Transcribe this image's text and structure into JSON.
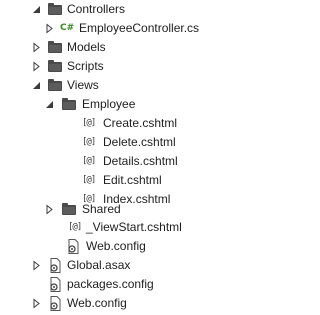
{
  "tree": {
    "rows": [
      {
        "label": "Controllers",
        "expander": "expanded",
        "icon": "folder-icon"
      },
      {
        "label": "EmployeeController.cs",
        "expander": "collapsed",
        "icon": "csharp-file-icon",
        "icon_text": "C#"
      },
      {
        "label": "Models",
        "expander": "collapsed",
        "icon": "folder-icon"
      },
      {
        "label": "Scripts",
        "expander": "collapsed",
        "icon": "folder-icon"
      },
      {
        "label": "Views",
        "expander": "expanded",
        "icon": "folder-icon"
      },
      {
        "label": "Employee",
        "expander": "expanded",
        "icon": "folder-icon"
      },
      {
        "label": "Create.cshtml",
        "expander": "none",
        "icon": "razor-file-icon",
        "icon_text": "[@]"
      },
      {
        "label": "Delete.cshtml",
        "expander": "none",
        "icon": "razor-file-icon",
        "icon_text": "[@]"
      },
      {
        "label": "Details.cshtml",
        "expander": "none",
        "icon": "razor-file-icon",
        "icon_text": "[@]"
      },
      {
        "label": "Edit.cshtml",
        "expander": "none",
        "icon": "razor-file-icon",
        "icon_text": "[@]"
      },
      {
        "label": "Index.cshtml",
        "expander": "none",
        "icon": "razor-file-icon",
        "icon_text": "[@]"
      },
      {
        "label": "Shared",
        "expander": "collapsed",
        "icon": "folder-icon"
      },
      {
        "label": "_ViewStart.cshtml",
        "expander": "none",
        "icon": "razor-file-icon",
        "icon_text": "[@]"
      },
      {
        "label": "Web.config",
        "expander": "none",
        "icon": "config-file-icon"
      },
      {
        "label": "Global.asax",
        "expander": "collapsed",
        "icon": "asax-file-icon"
      },
      {
        "label": "packages.config",
        "expander": "none",
        "icon": "config-file-icon"
      },
      {
        "label": "Web.config",
        "expander": "collapsed",
        "icon": "config-file-icon"
      }
    ]
  },
  "colors": {
    "background": "#ffffff",
    "text": "#1e1e1e",
    "icon_dark": "#4a4a4a",
    "csharp_green": "#378a1f"
  }
}
